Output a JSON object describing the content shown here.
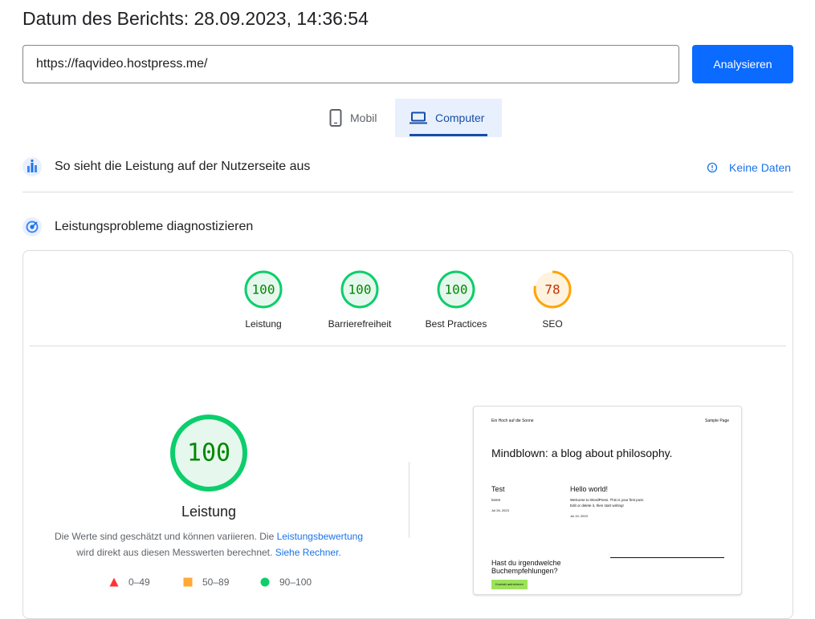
{
  "header": {
    "title": "Datum des Berichts: 28.09.2023, 14:36:54"
  },
  "search": {
    "url_value": "https://faqvideo.hostpress.me/",
    "analyze_label": "Analysieren"
  },
  "device_tabs": [
    {
      "label": "Mobil",
      "icon": "phone-icon",
      "selected": false
    },
    {
      "label": "Computer",
      "icon": "laptop-icon",
      "selected": true
    }
  ],
  "field_section": {
    "title": "So sieht die Leistung auf der Nutzerseite aus",
    "no_data_label": "Keine Daten",
    "icon": "field-data-icon"
  },
  "lab_section": {
    "title": "Leistungsprobleme diagnostizieren",
    "icon": "diagnose-icon"
  },
  "scores": [
    {
      "label": "Leistung",
      "value": "100",
      "fraction": 1.0,
      "status": "good"
    },
    {
      "label": "Barrierefreiheit",
      "value": "100",
      "fraction": 1.0,
      "status": "good"
    },
    {
      "label": "Best Practices",
      "value": "100",
      "fraction": 1.0,
      "status": "good"
    },
    {
      "label": "SEO",
      "value": "78",
      "fraction": 0.78,
      "status": "average"
    }
  ],
  "main_score": {
    "value": "100",
    "fraction": 1.0,
    "label": "Leistung",
    "desc_part1": "Die Werte sind geschätzt und können variieren. Die ",
    "desc_link1": "Leistungsbewertung",
    "desc_part2": "wird direkt aus diesen Messwerten berechnet. ",
    "desc_link2": "Siehe Rechner."
  },
  "legend": [
    {
      "range": "0–49",
      "shape": "triangle",
      "color": "#ff3333"
    },
    {
      "range": "50–89",
      "shape": "square",
      "color": "#ffaa33"
    },
    {
      "range": "90–100",
      "shape": "circle",
      "color": "#0cce6b"
    }
  ],
  "colors": {
    "good": "#0cce6b",
    "good_text": "#008800",
    "good_bg": "#e6f8ed",
    "average": "#ffa400",
    "average_text": "#c33300",
    "average_bg": "#fff3e0",
    "accent": "#1a73e8",
    "button": "#0b6aff"
  },
  "screenshot": {
    "site_name": "Ein Hoch auf die Sonne",
    "nav_item": "Sample Page",
    "headline": "Mindblown: a blog about philosophy.",
    "post1_title": "Test",
    "post1_text": "lorem",
    "post1_date": "Jul 26, 2023",
    "post2_title": "Hello world!",
    "post2_line1": "Welcome to WordPress. This is your first post.",
    "post2_line2": "Edit or delete it, then start writing!",
    "post2_date": "Jul 19, 2023",
    "cta_line1": "Hast du irgendwelche",
    "cta_line2": "Buchempfehlungen?",
    "cta_button": "Kontakt aufnehmen"
  }
}
